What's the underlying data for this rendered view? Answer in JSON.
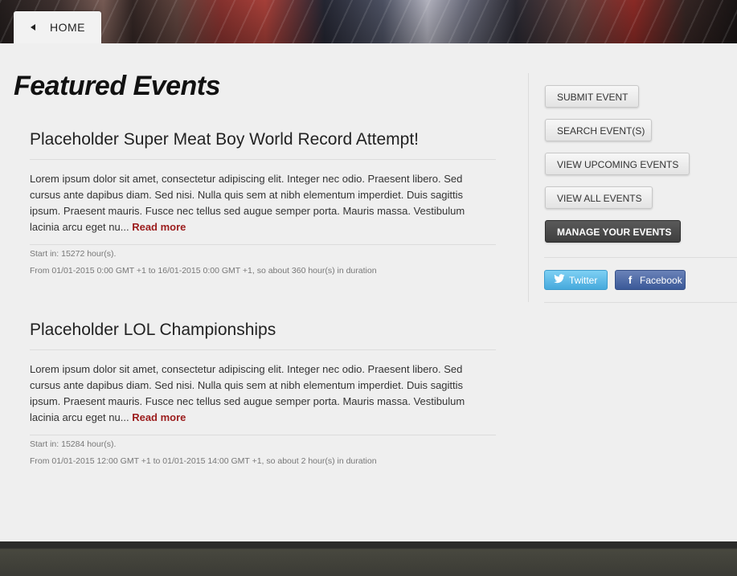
{
  "header": {
    "home_label": "HOME"
  },
  "main": {
    "title": "Featured Events",
    "events": [
      {
        "title": "Placeholder Super Meat Boy World Record Attempt!",
        "description": "Lorem ipsum dolor sit amet, consectetur adipiscing elit. Integer nec odio. Praesent libero. Sed cursus ante dapibus diam. Sed nisi. Nulla quis sem at nibh elementum imperdiet. Duis sagittis ipsum. Praesent mauris. Fusce nec tellus sed augue semper porta. Mauris massa. Vestibulum lacinia arcu eget nu...",
        "read_more": "Read more",
        "start_in": "Start in: 15272 hour(s).",
        "duration": "From 01/01-2015 0:00 GMT +1 to 16/01-2015 0:00 GMT +1, so about 360 hour(s) in duration"
      },
      {
        "title": "Placeholder LOL Championships",
        "description": "Lorem ipsum dolor sit amet, consectetur adipiscing elit. Integer nec odio. Praesent libero. Sed cursus ante dapibus diam. Sed nisi. Nulla quis sem at nibh elementum imperdiet. Duis sagittis ipsum. Praesent mauris. Fusce nec tellus sed augue semper porta. Mauris massa. Vestibulum lacinia arcu eget nu...",
        "read_more": "Read more",
        "start_in": "Start in: 15284 hour(s).",
        "duration": "From 01/01-2015 12:00 GMT +1 to 01/01-2015 14:00 GMT +1, so about 2 hour(s) in duration"
      }
    ]
  },
  "sidebar": {
    "buttons": {
      "submit": "SUBMIT EVENT",
      "search": "SEARCH EVENT(S)",
      "upcoming": "VIEW UPCOMING EVENTS",
      "all": "VIEW ALL EVENTS",
      "manage": "MANAGE YOUR EVENTS"
    },
    "social": {
      "twitter": "Twitter",
      "facebook": "Facebook"
    }
  },
  "colors": {
    "read_more": "#9b1c1c",
    "twitter": "#46a9dc",
    "facebook": "#3b5998",
    "manage_button": "#3e3e3e"
  },
  "icons": {
    "home": "triangle-left-icon",
    "twitter": "twitter-bird-icon",
    "facebook": "facebook-f-icon"
  }
}
